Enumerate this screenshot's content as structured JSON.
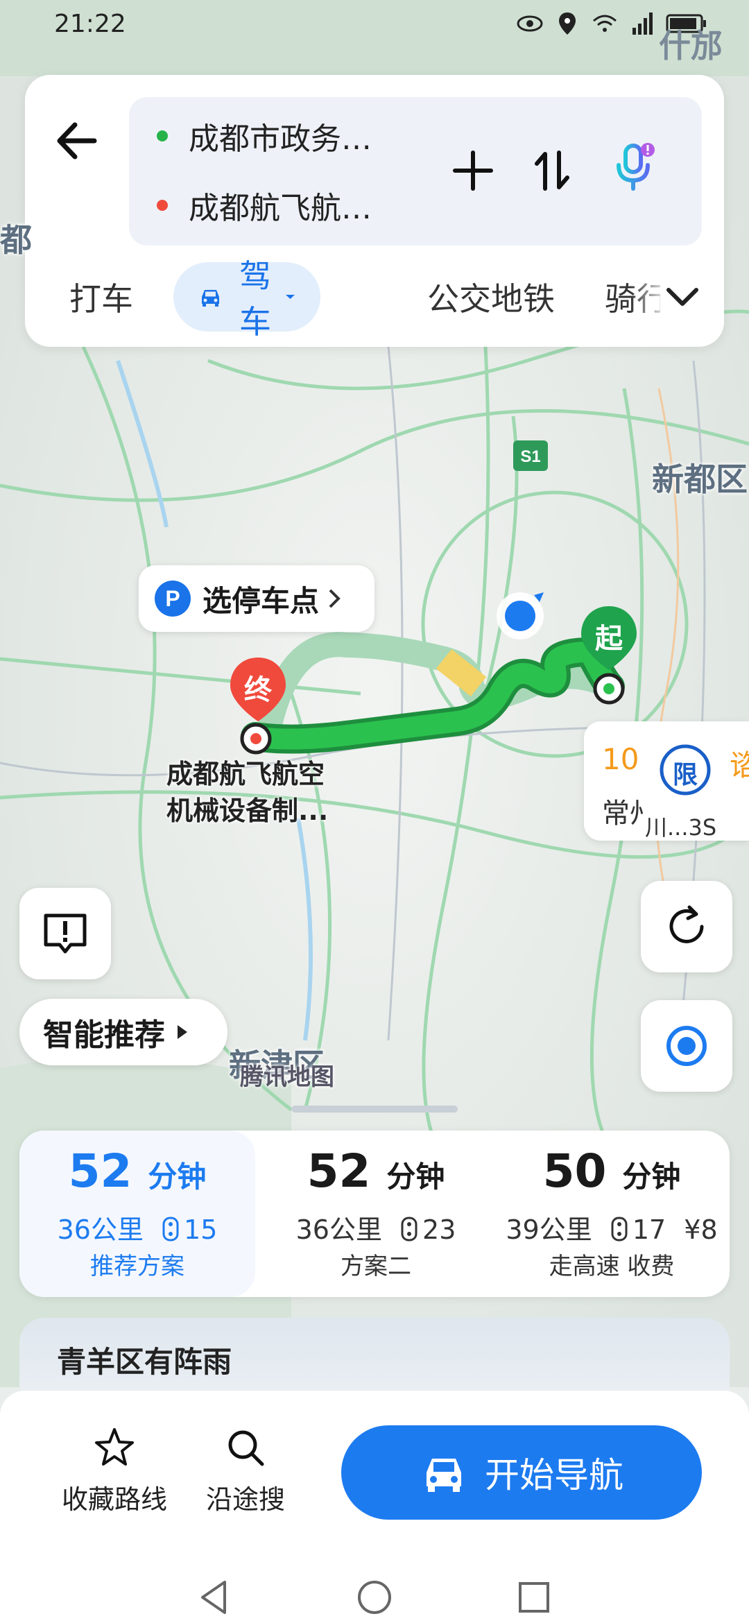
{
  "status_bar": {
    "time": "21:22",
    "corner_text": "什邡市"
  },
  "route_inputs": {
    "origin": "成都市政务…",
    "destination": "成都航飞航…"
  },
  "tabs": [
    {
      "label": "打车"
    },
    {
      "label": "驾车"
    },
    {
      "label": "公交地铁"
    },
    {
      "label": "骑行"
    }
  ],
  "map": {
    "labels": {
      "xindu": "新都区",
      "xinjin": "新津区",
      "left_edge": "都",
      "watermark": "腾讯地图",
      "highway": "S1",
      "end_name_line1": "成都航飞航空",
      "end_name_line2": "机械设备制..."
    },
    "park_chip": "选停车点",
    "start_marker": "起",
    "end_marker": "终",
    "restriction": {
      "limit_char": "限",
      "count": "10",
      "city": "常州",
      "plate": "川...3S",
      "trailing": "谘"
    },
    "smart_recommend": "智能推荐"
  },
  "routes": [
    {
      "minutes": "52",
      "unit": "分钟",
      "distance": "36公里",
      "lights": "15",
      "toll": "",
      "tag": "推荐方案",
      "selected": true
    },
    {
      "minutes": "52",
      "unit": "分钟",
      "distance": "36公里",
      "lights": "23",
      "toll": "",
      "tag": "方案二",
      "selected": false
    },
    {
      "minutes": "50",
      "unit": "分钟",
      "distance": "39公里",
      "lights": "17",
      "toll": "¥8",
      "tag": "走高速 收费",
      "selected": false
    }
  ],
  "weather": {
    "text": "青羊区有阵雨"
  },
  "bottom_bar": {
    "favorite": "收藏路线",
    "search_along": "沿途搜",
    "start_nav": "开始导航"
  },
  "colors": {
    "accent": "#1d7bf0",
    "route_green": "#27b34a",
    "end_red": "#f04a3c"
  }
}
